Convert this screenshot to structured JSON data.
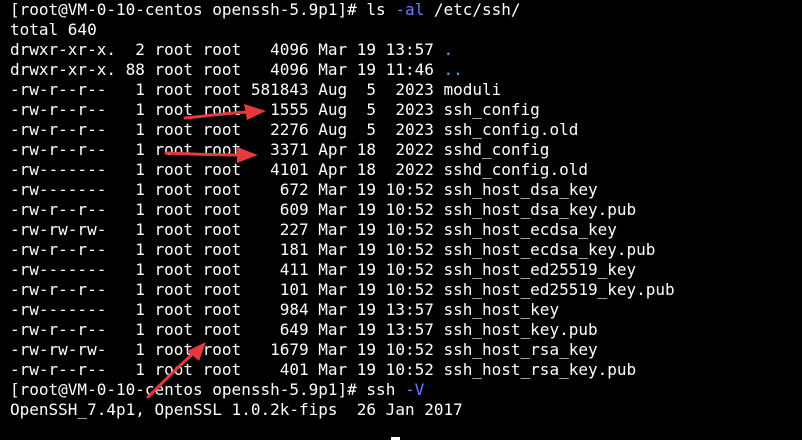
{
  "terminal": {
    "prompt_1": "[root@VM-0-10-centos openssh-5.9p1]# ",
    "command_1_base": "ls ",
    "command_1_option": "-al",
    "command_1_arg": " /etc/ssh/",
    "total_line": "total 640",
    "dir_entries": [
      {
        "meta": "drwxr-xr-x.  2 root root   4096 Mar 19 13:57 ",
        "name": "."
      },
      {
        "meta": "drwxr-xr-x. 88 root root   4096 Mar 19 11:46 ",
        "name": ".."
      }
    ],
    "file_entries": [
      "-rw-r--r--   1 root root 581843 Aug  5  2023 moduli",
      "-rw-r--r--   1 root root   1555 Aug  5  2023 ssh_config",
      "-rw-r--r--   1 root root   2276 Aug  5  2023 ssh_config.old",
      "-rw-r--r--   1 root root   3371 Apr 18  2022 sshd_config",
      "-rw-------   1 root root   4101 Apr 18  2022 sshd_config.old",
      "-rw-------   1 root root    672 Mar 19 10:52 ssh_host_dsa_key",
      "-rw-r--r--   1 root root    609 Mar 19 10:52 ssh_host_dsa_key.pub",
      "-rw-rw-rw-   1 root root    227 Mar 19 10:52 ssh_host_ecdsa_key",
      "-rw-r--r--   1 root root    181 Mar 19 10:52 ssh_host_ecdsa_key.pub",
      "-rw-------   1 root root    411 Mar 19 10:52 ssh_host_ed25519_key",
      "-rw-r--r--   1 root root    101 Mar 19 10:52 ssh_host_ed25519_key.pub",
      "-rw-------   1 root root    984 Mar 19 13:57 ssh_host_key",
      "-rw-r--r--   1 root root    649 Mar 19 13:57 ssh_host_key.pub",
      "-rw-rw-rw-   1 root root   1679 Mar 19 10:52 ssh_host_rsa_key",
      "-rw-r--r--   1 root root    401 Mar 19 10:52 ssh_host_rsa_key.pub"
    ],
    "prompt_2": "[root@VM-0-10-centos openssh-5.9p1]# ",
    "command_2_base": "ssh ",
    "command_2_option": "-V",
    "version_output": "OpenSSH_7.4p1, OpenSSL 1.0.2k-fips  26 Jan 2017"
  },
  "colors": {
    "background": "#000000",
    "text": "#ffffff",
    "option": "#6f7dff",
    "directory": "#4fa8ff",
    "annotation_arrow": "#e8383d"
  }
}
